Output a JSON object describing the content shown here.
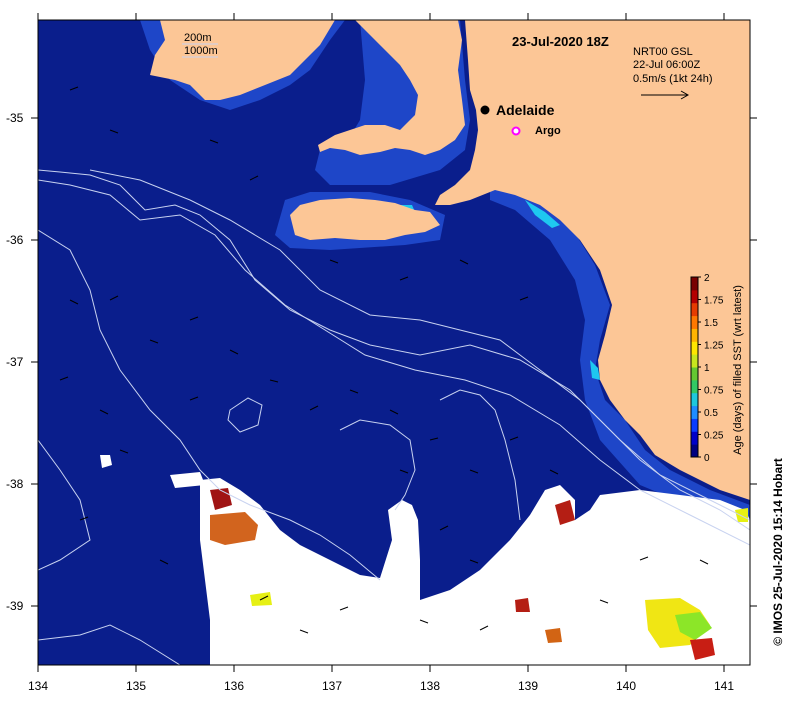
{
  "map": {
    "timestamp": "23-Jul-2020 18Z",
    "city_label": "Adelaide",
    "argo_label": "Argo",
    "depth_legend": [
      "200m",
      "1000m"
    ],
    "current_info": [
      "NRT00 GSL",
      "22-Jul 06:00Z",
      "0.5m/s (1kt 24h)"
    ],
    "credit": "© IMOS 25-Jul-2020 15:14 Hobart",
    "lon_ticks": [
      "134",
      "135",
      "136",
      "137",
      "138",
      "139",
      "140",
      "141"
    ],
    "lat_ticks": [
      "-35",
      "-36",
      "-37",
      "-38",
      "-39"
    ],
    "colorbar": {
      "label": "Age (days) of filled SST (wrt latest)",
      "tick_labels": [
        "2",
        "1.75",
        "1.5",
        "1.25",
        "1",
        "0.75",
        "0.5",
        "0.25",
        "0"
      ],
      "colors": [
        "#000080",
        "#0000c8",
        "#0a3cff",
        "#1e8cff",
        "#1ec8dc",
        "#32c864",
        "#64c832",
        "#c8e61e",
        "#ffe600",
        "#ffb400",
        "#ff7800",
        "#e63c00",
        "#b40000",
        "#780000"
      ]
    },
    "colors": {
      "ocean": "#0a1e8c",
      "land": "#fcc696",
      "no_data": "#ffffff",
      "coastal_band": "#1e46c8",
      "isobath": "#c8d2f0"
    }
  }
}
